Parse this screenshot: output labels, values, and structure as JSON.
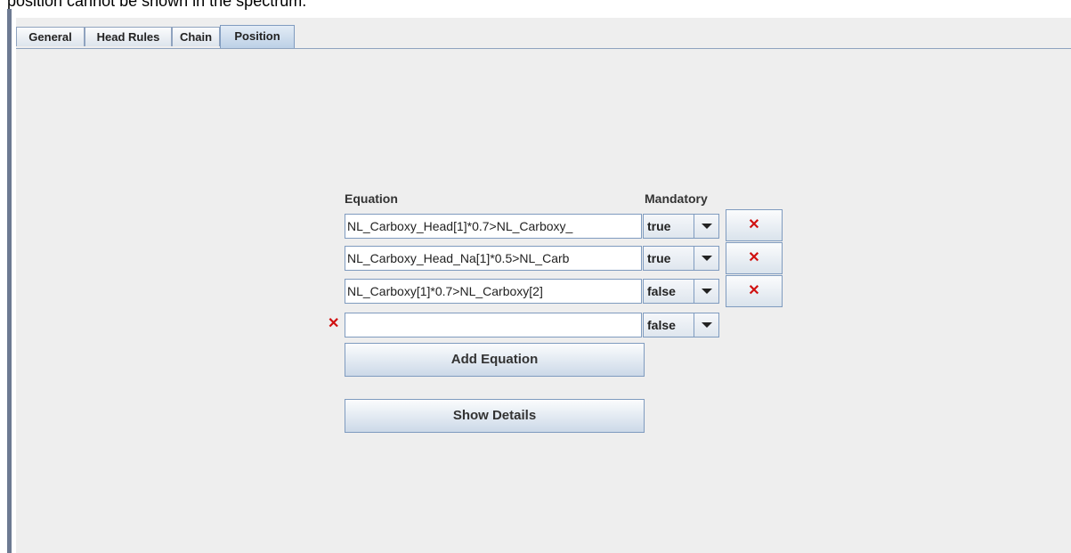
{
  "doc": {
    "caption_text": "position cannot be shown in the spectrum."
  },
  "tabs": [
    {
      "label": "General",
      "active": false
    },
    {
      "label": "Head Rules",
      "active": false
    },
    {
      "label": "Chain",
      "active": false
    },
    {
      "label": "Position",
      "active": true
    }
  ],
  "table": {
    "equation_header": "Equation",
    "mandatory_header": "Mandatory",
    "rows": [
      {
        "equation": "NL_Carboxy_Head[1]*0.7>NL_Carboxy_",
        "mandatory": "true",
        "delete_glyph": "✕"
      },
      {
        "equation": "NL_Carboxy_Head_Na[1]*0.5>NL_Carb",
        "mandatory": "true",
        "delete_glyph": "✕"
      },
      {
        "equation": "NL_Carboxy[1]*0.7>NL_Carboxy[2]",
        "mandatory": "false",
        "delete_glyph": "✕"
      },
      {
        "equation": "",
        "mandatory": "false",
        "error_glyph": "✕"
      }
    ]
  },
  "buttons": {
    "add_equation": "Add Equation",
    "show_details": "Show Details"
  },
  "colors": {
    "error_red": "#d01010",
    "frame_border": "#6d7a92",
    "panel_bg": "#eeeeee"
  },
  "icons": {
    "delete": "close-icon",
    "error": "error-icon",
    "dropdown": "chevron-down-icon"
  }
}
